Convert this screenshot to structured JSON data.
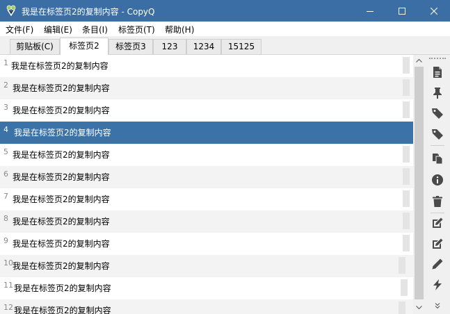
{
  "window": {
    "title": "我是在标签页2的复制内容 - CopyQ",
    "titlebar_color": "#3a6ea5"
  },
  "menu": [
    {
      "label": "文件(F)"
    },
    {
      "label": "编辑(E)"
    },
    {
      "label": "条目(I)"
    },
    {
      "label": "标签页(T)"
    },
    {
      "label": "帮助(H)"
    }
  ],
  "tabs": [
    {
      "label": "剪贴板(C)"
    },
    {
      "label": "标签页2",
      "active": true
    },
    {
      "label": "标签页3"
    },
    {
      "label": "123"
    },
    {
      "label": "1234"
    },
    {
      "label": "15125"
    }
  ],
  "items": [
    {
      "num": "1",
      "text": "我是在标签页2的复制内容"
    },
    {
      "num": "2",
      "text": "我是在标签页2的复制内容"
    },
    {
      "num": "3",
      "text": "我是在标签页2的复制内容"
    },
    {
      "num": "4",
      "text": "我是在标签页2的复制内容",
      "selected": true
    },
    {
      "num": "5",
      "text": "我是在标签页2的复制内容"
    },
    {
      "num": "6",
      "text": "我是在标签页2的复制内容"
    },
    {
      "num": "7",
      "text": "我是在标签页2的复制内容"
    },
    {
      "num": "8",
      "text": "我是在标签页2的复制内容"
    },
    {
      "num": "9",
      "text": "我是在标签页2的复制内容"
    },
    {
      "num": "10",
      "text": "我是在标签页2的复制内容"
    },
    {
      "num": "11",
      "text": "我是在标签页2的复制内容"
    },
    {
      "num": "12",
      "text": "我是在标签页2的复制内容"
    }
  ],
  "toolbar_icons": [
    "new-item-icon",
    "pin-icon",
    "tag-icon",
    "tag-icon",
    "copy-icon",
    "info-icon",
    "trash-icon",
    "edit-icon",
    "edit-external-icon",
    "pencil-icon",
    "action-icon"
  ],
  "colors": {
    "selection": "#3b73a8",
    "tool_icon": "#4a4a4a"
  }
}
